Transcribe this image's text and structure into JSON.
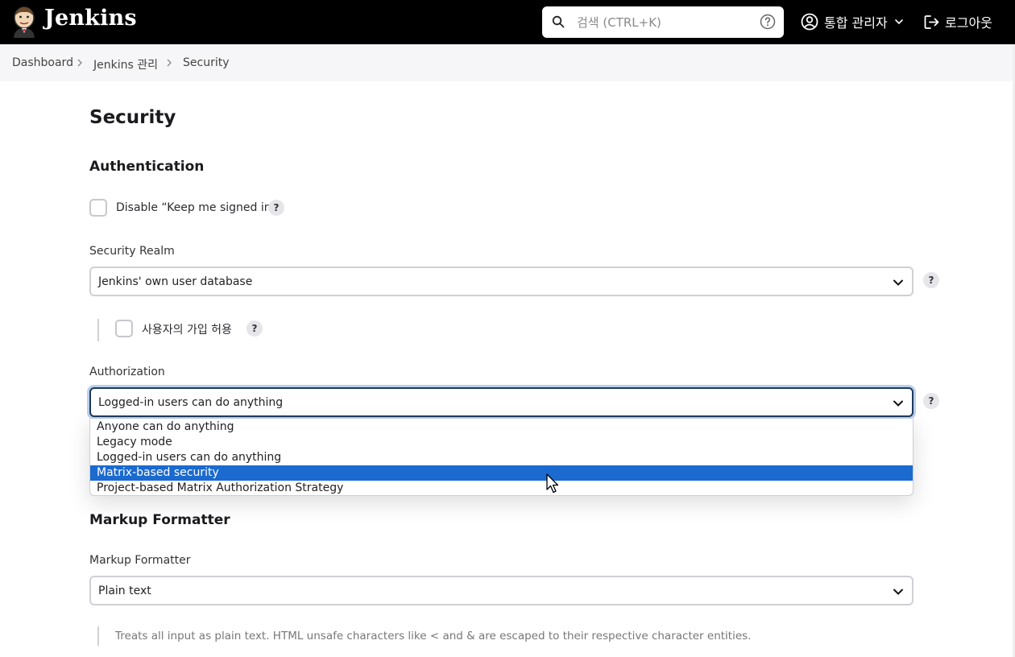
{
  "header": {
    "app_name": "Jenkins",
    "search": {
      "placeholder": "검색 (CTRL+K)",
      "value": ""
    },
    "user_name": "통합 관리자",
    "logout_label": "로그아웃",
    "background_color": "#000000"
  },
  "breadcrumb": [
    "Dashboard",
    "Jenkins 관리",
    "Security"
  ],
  "page_title": "Security",
  "authentication": {
    "heading": "Authentication",
    "disable_keep_signed_in": {
      "label": "Disable “Keep me signed in”",
      "checked": false
    },
    "security_realm": {
      "label": "Security Realm",
      "value": "Jenkins' own user database",
      "allow_signup": {
        "label": "사용자의 가입 허용",
        "checked": false
      }
    }
  },
  "authorization": {
    "label": "Authorization",
    "value": "Logged-in users can do anything",
    "options": [
      "Anyone can do anything",
      "Legacy mode",
      "Logged-in users can do anything",
      "Matrix-based security",
      "Project-based Matrix Authorization Strategy"
    ],
    "highlighted_option": "Matrix-based security",
    "highlight_color": "#1a6ad0"
  },
  "markup_formatter": {
    "heading": "Markup Formatter",
    "label": "Markup Formatter",
    "value": "Plain text",
    "description": "Treats all input as plain text. HTML unsafe characters like < and & are escaped to their respective character entities."
  },
  "help_glyph": "?"
}
